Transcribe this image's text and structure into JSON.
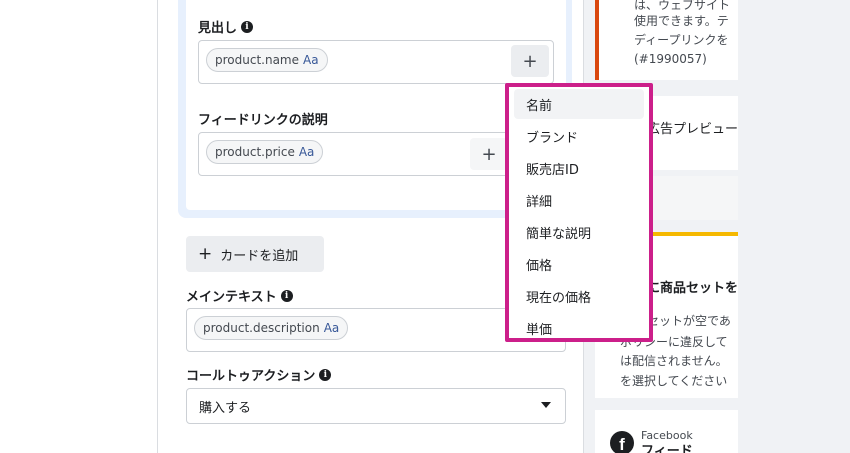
{
  "card": {
    "headline_label": "見出し",
    "headline_chip": "product.name",
    "link_desc_label": "フィードリンクの説明",
    "link_desc_chip": "product.price",
    "chip_suffix": "Aa",
    "plus_symbol": "+"
  },
  "add_card_label": "カードを追加",
  "add_card_plus": "+",
  "main_text": {
    "label": "メインテキスト",
    "chip": "product.description",
    "chip_suffix": "Aa"
  },
  "cta": {
    "label": "コールトゥアクション",
    "selected": "購入する"
  },
  "info_glyph": "i",
  "dropdown": {
    "items": [
      "名前",
      "ブランド",
      "販売店ID",
      "詳細",
      "簡単な説明",
      "価格",
      "現在の価格",
      "単価"
    ],
    "active_index": 0
  },
  "right_panel": {
    "notice_lines": [
      "は、ウェブサイト",
      "使用できます。テ",
      "ディープリンクを",
      "(#1990057)"
    ],
    "preview_label": "広告プレビュー",
    "product_set_heading": "に商品セットを",
    "product_set_lines": [
      "セットが空であ",
      "ポリシーに違反して",
      "は配信されません。",
      "を選択してください"
    ],
    "placement_brand": "Facebook",
    "placement_name": "フィード",
    "fb_glyph": "f"
  },
  "colors": {
    "highlight": "#cc1f8a",
    "selected_card": "#e7f0fd",
    "warning_bar": "#f5b800",
    "error_bar": "#d9480f"
  }
}
